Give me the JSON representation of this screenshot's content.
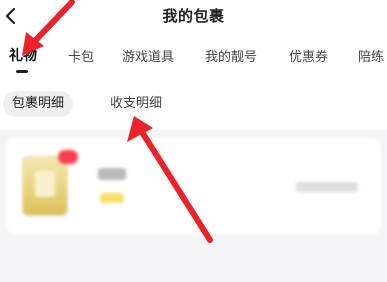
{
  "header": {
    "title": "我的包裹",
    "back_icon": "back-chevron-icon"
  },
  "tabs": [
    {
      "label": "礼物",
      "active": true
    },
    {
      "label": "卡包",
      "active": false
    },
    {
      "label": "游戏道具",
      "active": false
    },
    {
      "label": "我的靓号",
      "active": false
    },
    {
      "label": "优惠券",
      "active": false
    },
    {
      "label": "陪练",
      "active": false
    }
  ],
  "subtabs": [
    {
      "label": "包裹明细",
      "active": true
    },
    {
      "label": "收支明细",
      "active": false
    }
  ],
  "annotation_color": "#e8232a"
}
